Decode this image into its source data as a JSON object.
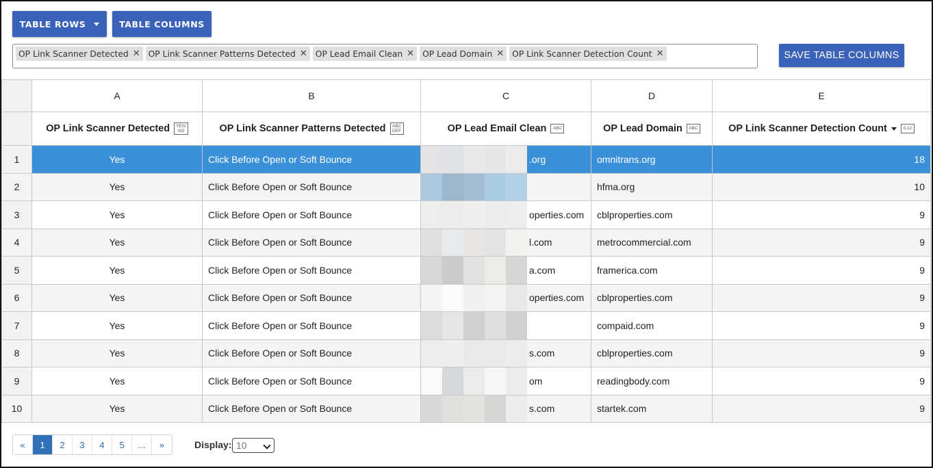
{
  "toolbar": {
    "table_rows_label": "TABLE ROWS",
    "table_columns_label": "TABLE COLUMNS",
    "save_label": "SAVE TABLE COLUMNS"
  },
  "selected_columns": [
    "OP Link Scanner Detected",
    "OP Link Scanner Patterns Detected",
    "OP Lead Email Clean",
    "OP Lead Domain",
    "OP Link Scanner Detection Count"
  ],
  "column_letters": [
    "A",
    "B",
    "C",
    "D",
    "E"
  ],
  "columns": [
    {
      "title": "OP Link Scanner Detected",
      "type_badge": "YES/\nNO"
    },
    {
      "title": "OP Link Scanner Patterns Detected",
      "type_badge": "ABC\nDEF"
    },
    {
      "title": "OP Lead Email Clean",
      "type_badge": "ABC"
    },
    {
      "title": "OP Lead Domain",
      "type_badge": "ABC"
    },
    {
      "title": "OP Link Scanner Detection Count",
      "type_badge": "0.12",
      "sorted": "descending"
    }
  ],
  "rows": [
    {
      "num": "1",
      "a": "Yes",
      "b": "Click Before Open or Soft Bounce",
      "c": ".org",
      "d": "omnitrans.org",
      "e": "18",
      "selected": true
    },
    {
      "num": "2",
      "a": "Yes",
      "b": "Click Before Open or Soft Bounce",
      "c": "",
      "d": "hfma.org",
      "e": "10"
    },
    {
      "num": "3",
      "a": "Yes",
      "b": "Click Before Open or Soft Bounce",
      "c": "operties.com",
      "d": "cblproperties.com",
      "e": "9"
    },
    {
      "num": "4",
      "a": "Yes",
      "b": "Click Before Open or Soft Bounce",
      "c": "l.com",
      "d": "metrocommercial.com",
      "e": "9"
    },
    {
      "num": "5",
      "a": "Yes",
      "b": "Click Before Open or Soft Bounce",
      "c": "a.com",
      "d": "framerica.com",
      "e": "9"
    },
    {
      "num": "6",
      "a": "Yes",
      "b": "Click Before Open or Soft Bounce",
      "c": "operties.com",
      "d": "cblproperties.com",
      "e": "9"
    },
    {
      "num": "7",
      "a": "Yes",
      "b": "Click Before Open or Soft Bounce",
      "c": "",
      "d": "compaid.com",
      "e": "9"
    },
    {
      "num": "8",
      "a": "Yes",
      "b": "Click Before Open or Soft Bounce",
      "c": "s.com",
      "d": "cblproperties.com",
      "e": "9"
    },
    {
      "num": "9",
      "a": "Yes",
      "b": "Click Before Open or Soft Bounce",
      "c": "om",
      "d": "readingbody.com",
      "e": "9"
    },
    {
      "num": "10",
      "a": "Yes",
      "b": "Click Before Open or Soft Bounce",
      "c": "s.com",
      "d": "startek.com",
      "e": "9"
    }
  ],
  "pagination": {
    "prev": "«",
    "pages": [
      "1",
      "2",
      "3",
      "4",
      "5"
    ],
    "ellipsis": "...",
    "next": "»",
    "current": "1"
  },
  "display": {
    "label": "Display:",
    "value": "10"
  },
  "colors": {
    "primary_button": "#3a62b8",
    "selected_row": "#3a91d8",
    "pagination_active": "#2f72b8"
  }
}
